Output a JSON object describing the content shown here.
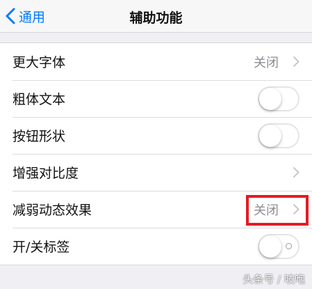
{
  "nav": {
    "back_label": "通用",
    "title": "辅助功能"
  },
  "settings": {
    "rows": [
      {
        "label": "更大字体",
        "value": "关闭",
        "control": "chevron"
      },
      {
        "label": "粗体文本",
        "control": "toggle",
        "state": "off"
      },
      {
        "label": "按钮形状",
        "control": "toggle",
        "state": "off"
      },
      {
        "label": "增强对比度",
        "control": "chevron"
      },
      {
        "label": "减弱动态效果",
        "value": "关闭",
        "control": "chevron",
        "highlighted": true
      },
      {
        "label": "开/关标签",
        "control": "toggle",
        "state": "off"
      }
    ]
  },
  "watermark": "头条号 / 吱咆",
  "colors": {
    "accent": "#007aff",
    "highlight_box": "#e41b23",
    "background": "#efeff4",
    "secondary_text": "#8e8e93"
  },
  "icons": {
    "back": "chevron-left-icon",
    "disclosure": "chevron-right-icon"
  }
}
